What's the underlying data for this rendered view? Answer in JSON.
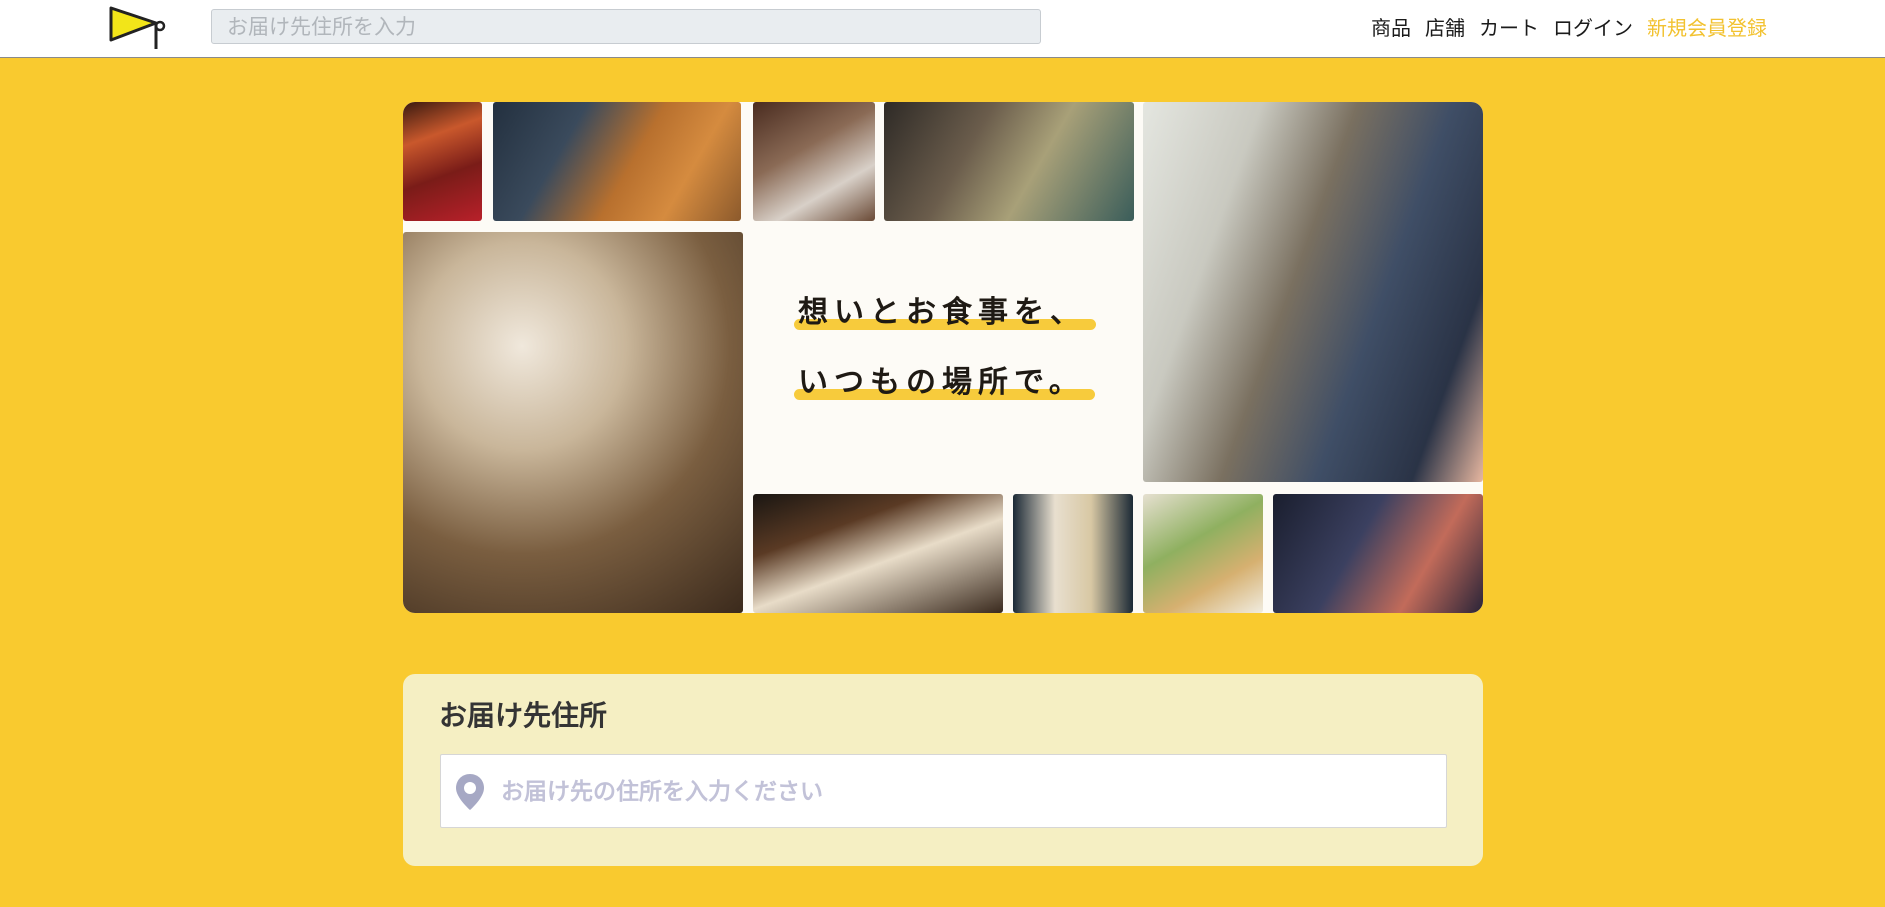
{
  "header": {
    "search_placeholder": "お届け先住所を入力",
    "nav": {
      "products": "商品",
      "stores": "店舗",
      "cart": "カート",
      "login": "ログイン",
      "register": "新規会員登録"
    }
  },
  "hero": {
    "line1": "想いとお食事を、",
    "line2": "いつもの場所で。"
  },
  "address": {
    "title": "お届け先住所",
    "placeholder": "お届け先の住所を入力ください"
  },
  "colors": {
    "background": "#f9ca2f",
    "accent": "#f2c230",
    "card": "#f5efc3"
  }
}
